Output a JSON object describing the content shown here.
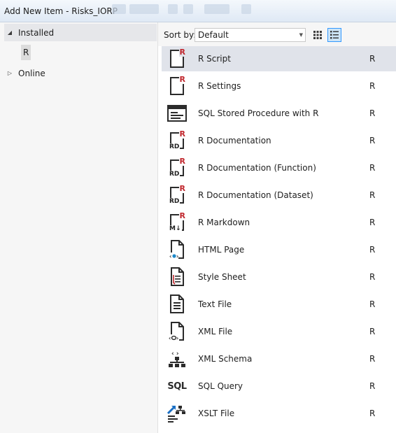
{
  "window": {
    "title": "Add New Item - Risks_IORP"
  },
  "tree": {
    "installed": {
      "label": "Installed",
      "arrow": "◢"
    },
    "r_child": {
      "label": "R"
    },
    "online": {
      "label": "Online",
      "arrow": "▷"
    }
  },
  "toolbar": {
    "sort_label": "Sort by:",
    "sort_value": "Default",
    "view_modes": [
      "small-icons",
      "list"
    ]
  },
  "items": [
    {
      "name": "R Script",
      "lang": "R",
      "icon": "r-script-icon"
    },
    {
      "name": "R Settings",
      "lang": "R",
      "icon": "r-settings-icon"
    },
    {
      "name": "SQL Stored Procedure with R",
      "lang": "R",
      "icon": "sql-stored-procedure-icon"
    },
    {
      "name": "R  Documentation",
      "lang": "R",
      "icon": "r-documentation-icon"
    },
    {
      "name": "R Documentation (Function)",
      "lang": "R",
      "icon": "r-documentation-function-icon"
    },
    {
      "name": "R Documentation (Dataset)",
      "lang": "R",
      "icon": "r-documentation-dataset-icon"
    },
    {
      "name": "R Markdown",
      "lang": "R",
      "icon": "r-markdown-icon"
    },
    {
      "name": "HTML Page",
      "lang": "R",
      "icon": "html-page-icon"
    },
    {
      "name": "Style Sheet",
      "lang": "R",
      "icon": "style-sheet-icon"
    },
    {
      "name": "Text File",
      "lang": "R",
      "icon": "text-file-icon"
    },
    {
      "name": "XML File",
      "lang": "R",
      "icon": "xml-file-icon"
    },
    {
      "name": "XML Schema",
      "lang": "R",
      "icon": "xml-schema-icon"
    },
    {
      "name": "SQL Query",
      "lang": "R",
      "icon": "sql-query-icon"
    },
    {
      "name": "XSLT File",
      "lang": "R",
      "icon": "xslt-file-icon"
    }
  ],
  "icon_text": {
    "r": "R",
    "rd": "RD",
    "md": "M↓",
    "sql": "SQL"
  },
  "colors": {
    "accent_red": "#c1272d",
    "selection": "#e0e3ea",
    "html_blue": "#1e88c8",
    "xslt_blue": "#1a6fc4"
  }
}
